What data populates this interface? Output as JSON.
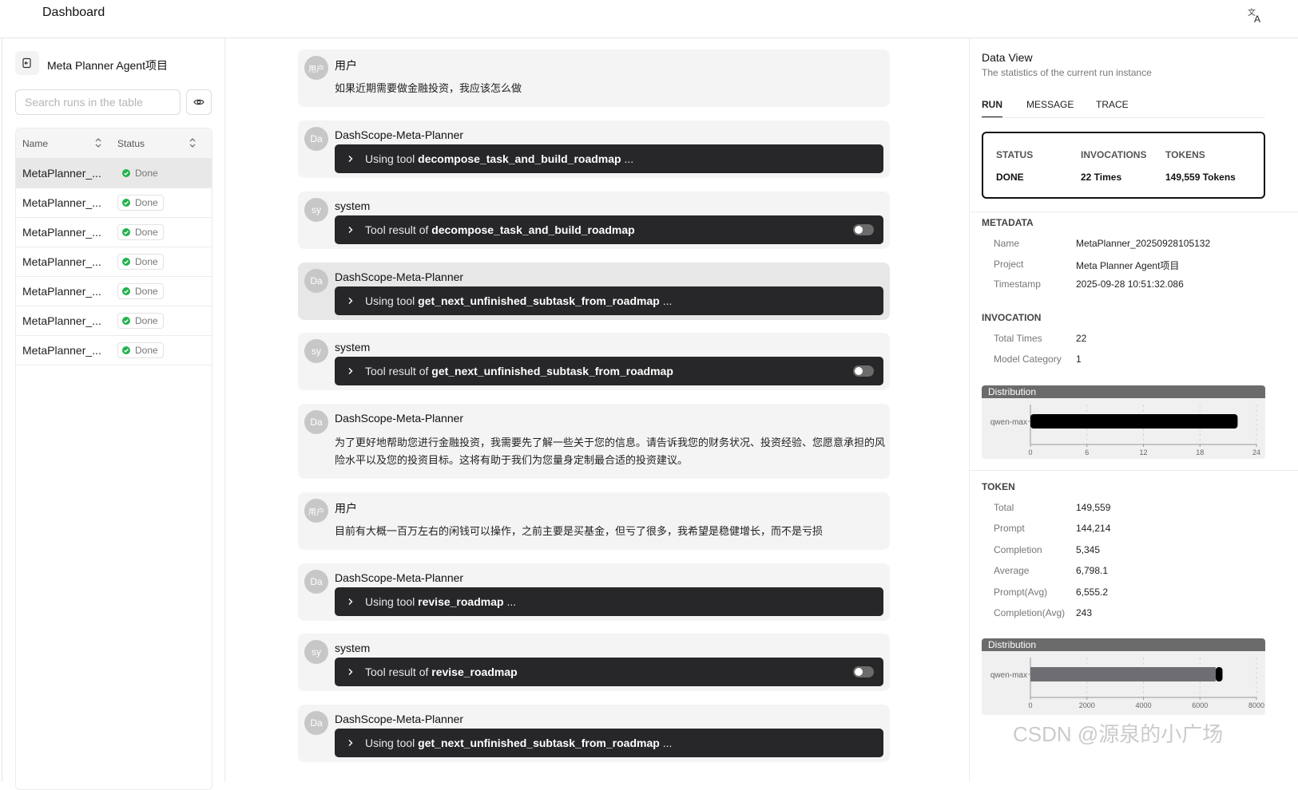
{
  "app": {
    "title": "Dashboard"
  },
  "left": {
    "project_name": "Meta Planner Agent项目",
    "search_placeholder": "Search runs in the table",
    "columns": {
      "name": "Name",
      "status": "Status"
    },
    "rows": [
      {
        "name": "MetaPlanner_...",
        "status": "Done"
      },
      {
        "name": "MetaPlanner_...",
        "status": "Done"
      },
      {
        "name": "MetaPlanner_...",
        "status": "Done"
      },
      {
        "name": "MetaPlanner_...",
        "status": "Done"
      },
      {
        "name": "MetaPlanner_...",
        "status": "Done"
      },
      {
        "name": "MetaPlanner_...",
        "status": "Done"
      },
      {
        "name": "MetaPlanner_...",
        "status": "Done"
      }
    ]
  },
  "messages": [
    {
      "avatar": "用户",
      "sender": "用户",
      "kind": "text",
      "text": "如果近期需要做金融投资，我应该怎么做"
    },
    {
      "avatar": "Da",
      "sender": "DashScope-Meta-Planner",
      "kind": "tool_use",
      "prefix": "Using tool",
      "tool": "decompose_task_and_build_roadmap",
      "suffix": "..."
    },
    {
      "avatar": "sy",
      "sender": "system",
      "kind": "tool_result",
      "prefix": "Tool result of",
      "tool": "decompose_task_and_build_roadmap"
    },
    {
      "avatar": "Da",
      "sender": "DashScope-Meta-Planner",
      "kind": "tool_use",
      "prefix": "Using tool",
      "tool": "get_next_unfinished_subtask_from_roadmap",
      "suffix": "..."
    },
    {
      "avatar": "sy",
      "sender": "system",
      "kind": "tool_result",
      "prefix": "Tool result of",
      "tool": "get_next_unfinished_subtask_from_roadmap"
    },
    {
      "avatar": "Da",
      "sender": "DashScope-Meta-Planner",
      "kind": "text",
      "text": "为了更好地帮助您进行金融投资，我需要先了解一些关于您的信息。请告诉我您的财务状况、投资经验、您愿意承担的风险水平以及您的投资目标。这将有助于我们为您量身定制最合适的投资建议。"
    },
    {
      "avatar": "用户",
      "sender": "用户",
      "kind": "text",
      "text": "目前有大概一百万左右的闲钱可以操作，之前主要是买基金，但亏了很多，我希望是稳健增长，而不是亏损"
    },
    {
      "avatar": "Da",
      "sender": "DashScope-Meta-Planner",
      "kind": "tool_use",
      "prefix": "Using tool",
      "tool": "revise_roadmap",
      "suffix": "..."
    },
    {
      "avatar": "sy",
      "sender": "system",
      "kind": "tool_result",
      "prefix": "Tool result of",
      "tool": "revise_roadmap"
    },
    {
      "avatar": "Da",
      "sender": "DashScope-Meta-Planner",
      "kind": "tool_use",
      "prefix": "Using tool",
      "tool": "get_next_unfinished_subtask_from_roadmap",
      "suffix": "..."
    }
  ],
  "right": {
    "title": "Data View",
    "subtitle": "The statistics of the current run instance",
    "tabs": [
      "RUN",
      "MESSAGE",
      "TRACE"
    ],
    "stats": {
      "status_label": "STATUS",
      "status_value": "DONE",
      "invocations_label": "INVOCATIONS",
      "invocations_value": "22 Times",
      "tokens_label": "TOKENS",
      "tokens_value": "149,559 Tokens"
    },
    "metadata": {
      "heading": "METADATA",
      "name_label": "Name",
      "name_value": "MetaPlanner_20250928105132",
      "project_label": "Project",
      "project_value": "Meta Planner Agent项目",
      "timestamp_label": "Timestamp",
      "timestamp_value": "2025-09-28 10:51:32.086"
    },
    "invocation": {
      "heading": "INVOCATION",
      "total_label": "Total Times",
      "total_value": "22",
      "category_label": "Model Category",
      "category_value": "1"
    },
    "token": {
      "heading": "TOKEN",
      "items": [
        {
          "label": "Total",
          "value": "149,559"
        },
        {
          "label": "Prompt",
          "value": "144,214"
        },
        {
          "label": "Completion",
          "value": "5,345"
        },
        {
          "label": "Average",
          "value": "6,798.1"
        },
        {
          "label": "Prompt(Avg)",
          "value": "6,555.2"
        },
        {
          "label": "Completion(Avg)",
          "value": "243"
        }
      ]
    },
    "distribution_label": "Distribution"
  },
  "watermark": "CSDN @源泉的小广场",
  "chart_data": [
    {
      "type": "bar",
      "title": "Distribution",
      "orientation": "horizontal",
      "categories": [
        "qwen-max"
      ],
      "series": [
        {
          "values": [
            22
          ]
        }
      ],
      "xlim": [
        0,
        24
      ],
      "xticks": [
        "0",
        "6",
        "12",
        "18",
        "24"
      ]
    },
    {
      "type": "bar",
      "title": "Distribution",
      "orientation": "horizontal",
      "stacked": true,
      "categories": [
        "qwen-max"
      ],
      "series": [
        {
          "values": [
            6555.2
          ]
        },
        {
          "values": [
            243
          ]
        }
      ],
      "xlim": [
        0,
        8000
      ],
      "xticks": [
        "0",
        "2000",
        "4000",
        "6000",
        "8000"
      ]
    }
  ]
}
